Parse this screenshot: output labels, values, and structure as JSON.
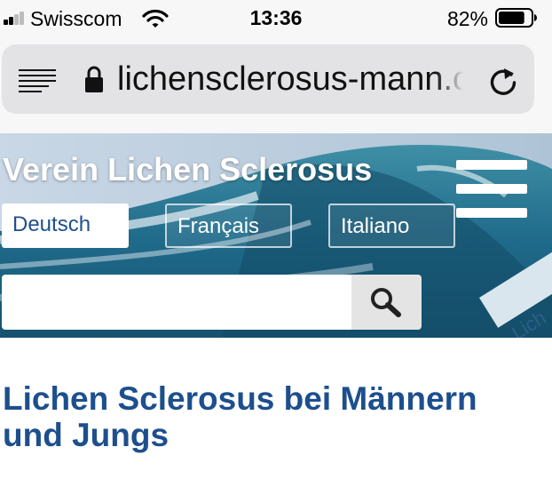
{
  "status_bar": {
    "carrier": "Swisscom",
    "time": "13:36",
    "battery_percent": "82%",
    "battery_level": 0.82
  },
  "browser": {
    "url": "lichensclerosus-mann.ch",
    "icons": [
      "reader-icon",
      "lock-icon",
      "reload-icon"
    ]
  },
  "site": {
    "title": "Verein Lichen Sclerosus",
    "languages": [
      {
        "label": "Deutsch",
        "active": true
      },
      {
        "label": "Français",
        "active": false
      },
      {
        "label": "Italiano",
        "active": false
      }
    ],
    "search": {
      "value": "",
      "placeholder": ""
    },
    "corner_text": "Lich"
  },
  "content": {
    "heading": "Lichen Sclerosus bei Männern und Jungs"
  },
  "colors": {
    "heading": "#1d4f8d",
    "active_language_text": "#1e4f8e",
    "status_bar_bg": "#f7f7f7",
    "url_bar_bg": "#e3e3e5"
  }
}
